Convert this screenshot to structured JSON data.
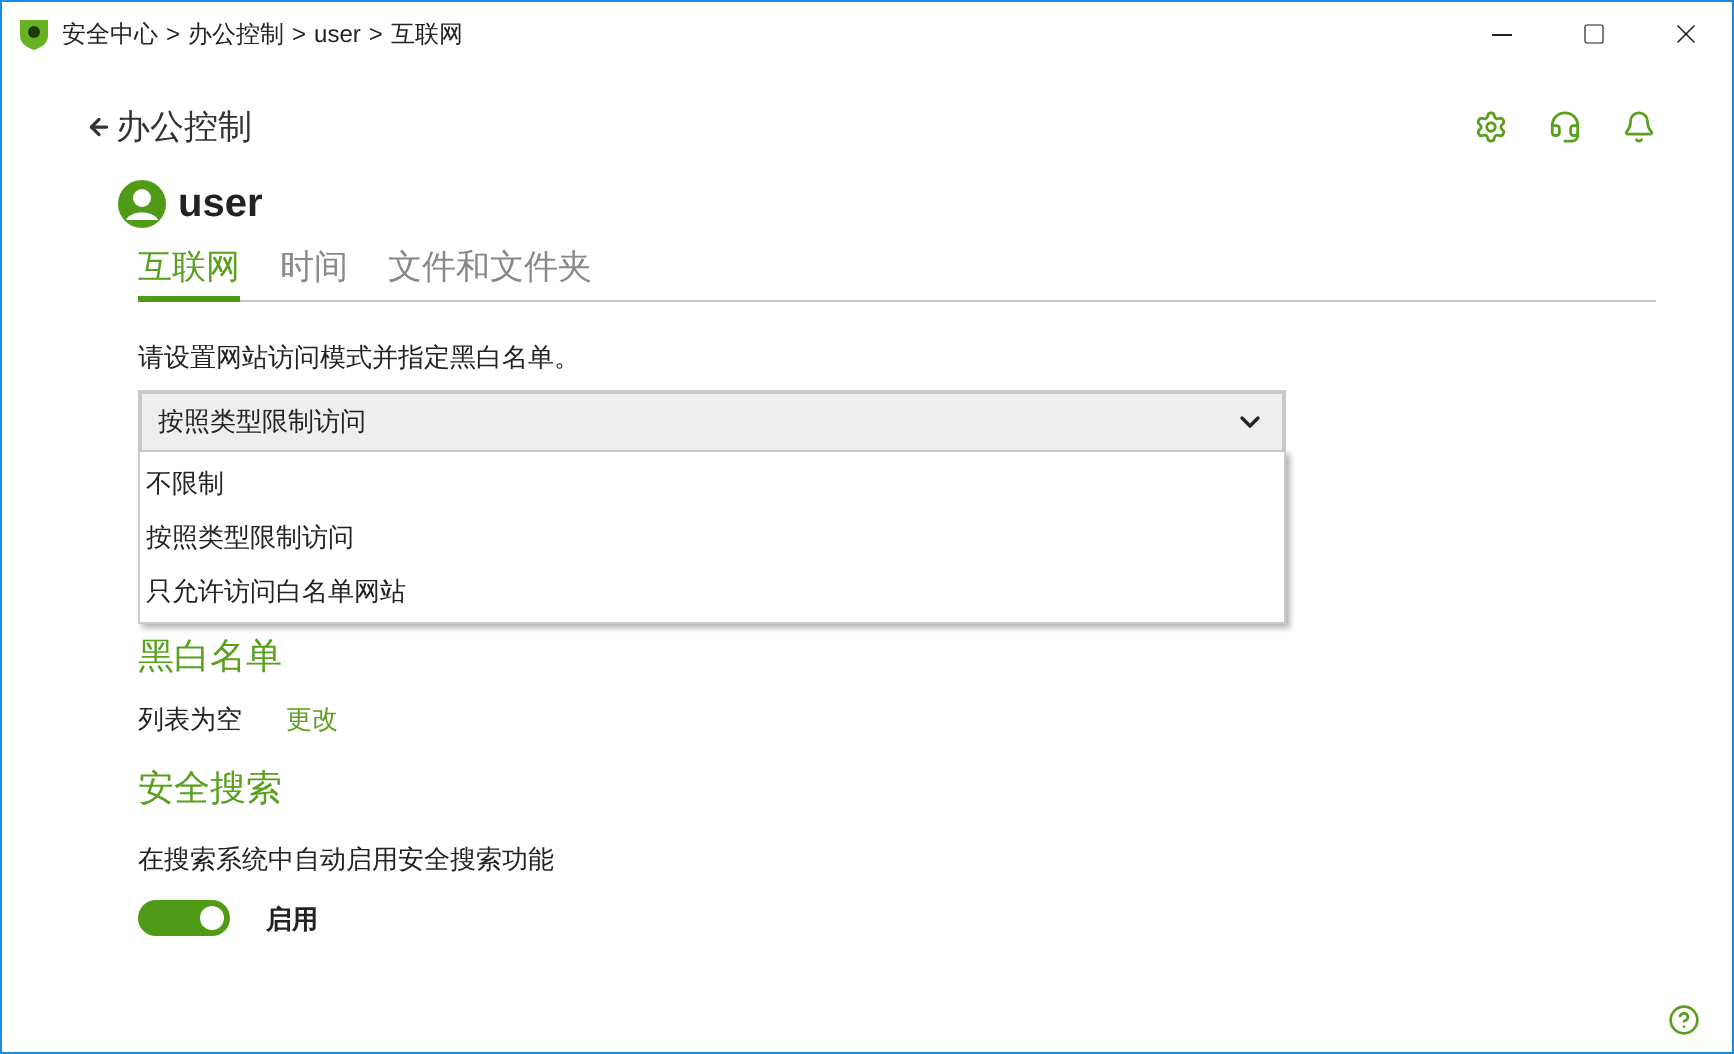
{
  "window": {
    "breadcrumb": [
      "安全中心",
      "办公控制",
      "user",
      "互联网"
    ],
    "separator": ">"
  },
  "back_link": "办公控制",
  "user": {
    "name": "user"
  },
  "tabs": [
    {
      "label": "互联网",
      "selected": true
    },
    {
      "label": "时间",
      "selected": false
    },
    {
      "label": "文件和文件夹",
      "selected": false
    }
  ],
  "access_mode": {
    "label": "请设置网站访问模式并指定黑白名单。",
    "value": "按照类型限制访问",
    "expanded": true,
    "options": [
      "不限制",
      "按照类型限制访问",
      "只允许访问白名单网站"
    ]
  },
  "blacklist": {
    "heading": "黑白名单",
    "status": "列表为空",
    "link": "更改"
  },
  "safe_search": {
    "heading": "安全搜索",
    "description": "在搜索系统中自动启用安全搜索功能",
    "on": true,
    "toggle_label": "启用"
  }
}
